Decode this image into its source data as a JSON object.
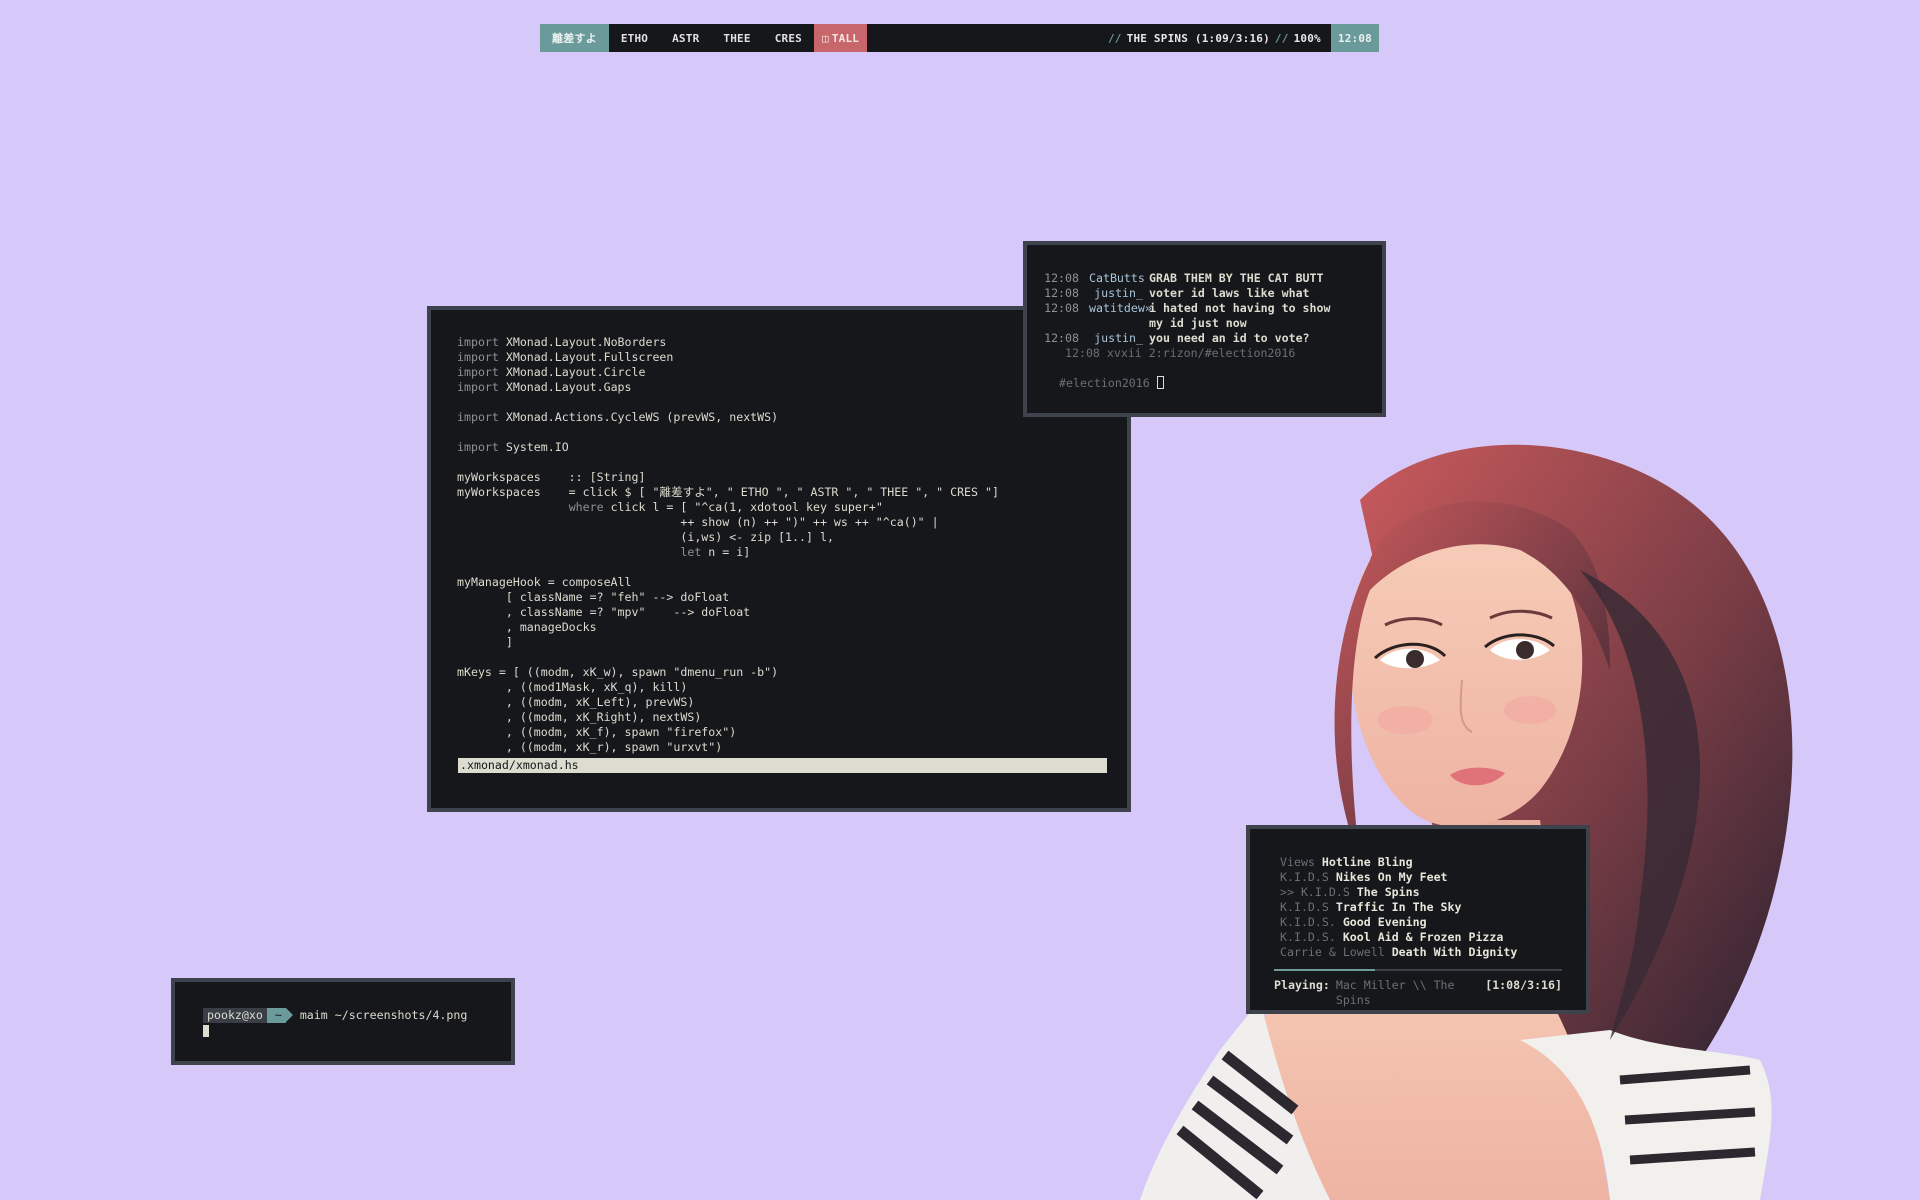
{
  "bar": {
    "workspaces": [
      "離差すよ",
      "ETHO",
      "ASTR",
      "THEE",
      "CRES"
    ],
    "layout": "TALL",
    "status_sep": "//",
    "now_playing": "THE SPINS (1:09/3:16)",
    "volume": "100%",
    "clock": "12:08"
  },
  "editor": {
    "lines": [
      "import XMonad.Layout.NoBorders",
      "import XMonad.Layout.Fullscreen",
      "import XMonad.Layout.Circle",
      "import XMonad.Layout.Gaps",
      "",
      "import XMonad.Actions.CycleWS (prevWS, nextWS)",
      "",
      "import System.IO",
      "",
      "myWorkspaces    :: [String]",
      "myWorkspaces    = click $ [ \"離差すよ\", \" ETHO \", \" ASTR \", \" THEE \", \" CRES \"]",
      "                where click l = [ \"^ca(1, xdotool key super+\"",
      "                                ++ show (n) ++ \")\" ++ ws ++ \"^ca()\" |",
      "                                (i,ws) <- zip [1..] l,",
      "                                let n = i]",
      "",
      "myManageHook = composeAll",
      "       [ className =? \"feh\" --> doFloat",
      "       , className =? \"mpv\"    --> doFloat",
      "       , manageDocks",
      "       ]",
      "",
      "mKeys = [ ((modm, xK_w), spawn \"dmenu_run -b\")",
      "       , ((mod1Mask, xK_q), kill)",
      "       , ((modm, xK_Left), prevWS)",
      "       , ((modm, xK_Right), nextWS)",
      "       , ((modm, xK_f), spawn \"firefox\")",
      "       , ((modm, xK_r), spawn \"urxvt\")"
    ],
    "statusline": ".xmonad/xmonad.hs"
  },
  "irc": {
    "messages": [
      {
        "time": "12:08",
        "nick": "CatButts",
        "text": "GRAB THEM BY THE CAT BUTT"
      },
      {
        "time": "12:08",
        "nick": "justin_",
        "text": "voter id laws like what"
      },
      {
        "time": "12:08",
        "nick": "watitdew»",
        "text": "i hated not having to show my id just now"
      },
      {
        "time": "12:08",
        "nick": "justin_",
        "text": "you need an id to vote?"
      }
    ],
    "status": "12:08 xvxii 2:rizon/#election2016",
    "channel_prompt": "#election2016"
  },
  "music": {
    "playlist": [
      {
        "prefix": "",
        "artist": "Views",
        "title": "Hotline Bling"
      },
      {
        "prefix": "",
        "artist": "K.I.D.S",
        "title": "Nikes On My Feet"
      },
      {
        "prefix": ">> ",
        "artist": "K.I.D.S",
        "title": "The Spins"
      },
      {
        "prefix": "",
        "artist": "K.I.D.S",
        "title": "Traffic In The Sky"
      },
      {
        "prefix": "",
        "artist": "K.I.D.S.",
        "title": "Good Evening"
      },
      {
        "prefix": "",
        "artist": "K.I.D.S.",
        "title": "Kool Aid & Frozen Pizza"
      },
      {
        "prefix": "",
        "artist": "Carrie & Lowell",
        "title": "Death With Dignity"
      }
    ],
    "playing_label": "Playing:",
    "now_playing": "Mac Miller \\\\ The Spins",
    "time": "[1:08/3:16]",
    "progress": 0.35
  },
  "shell": {
    "user": "pookz@xo",
    "dir": "~",
    "command": "maim ~/screenshots/4.png"
  },
  "colors": {
    "background": "#d6c9f9",
    "window": "#15171a",
    "border": "#3d424d",
    "accent": "#6b9a9a",
    "layout_badge": "#c8676b"
  }
}
